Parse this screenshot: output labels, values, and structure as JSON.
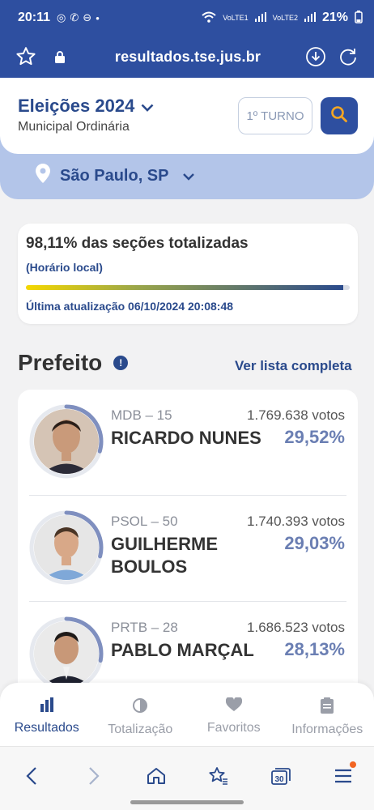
{
  "status_bar": {
    "time": "20:11",
    "network_1": "VoLTE1",
    "network_2": "VoLTE2",
    "battery": "21%"
  },
  "browser": {
    "url": "resultados.tse.jus.br"
  },
  "header": {
    "title": "Eleições 2024",
    "subtitle": "Municipal Ordinária",
    "turno_label": "1º TURNO"
  },
  "location": {
    "label": "São Paulo, SP"
  },
  "progress": {
    "title": "98,11% das seções totalizadas",
    "subtitle": "(Horário local)",
    "fraction": 0.9811,
    "updated": "Última atualização 06/10/2024 20:08:48"
  },
  "section": {
    "title": "Prefeito",
    "info": "!",
    "link": "Ver lista completa"
  },
  "candidates": [
    {
      "party": "MDB – 15",
      "votes": "1.769.638 votos",
      "name": "RICARDO NUNES",
      "pct": "29,52%",
      "share": 0.2952
    },
    {
      "party": "PSOL – 50",
      "votes": "1.740.393 votos",
      "name": "GUILHERME BOULOS",
      "pct": "29,03%",
      "share": 0.2903
    },
    {
      "party": "PRTB – 28",
      "votes": "1.686.523 votos",
      "name": "PABLO MARÇAL",
      "pct": "28,13%",
      "share": 0.2813
    }
  ],
  "app_nav": [
    {
      "label": "Resultados",
      "icon": "bar-chart-icon",
      "active": true
    },
    {
      "label": "Totalização",
      "icon": "pie-chart-icon",
      "active": false
    },
    {
      "label": "Favoritos",
      "icon": "heart-icon",
      "active": false
    },
    {
      "label": "Informações",
      "icon": "clipboard-icon",
      "active": false
    }
  ],
  "browser_nav": {
    "tabs_count": "30"
  },
  "colors": {
    "brand": "#2e4fa0",
    "accent": "#2a4a8c",
    "band": "#b3c5e9",
    "search_icon": "#f5a623"
  }
}
